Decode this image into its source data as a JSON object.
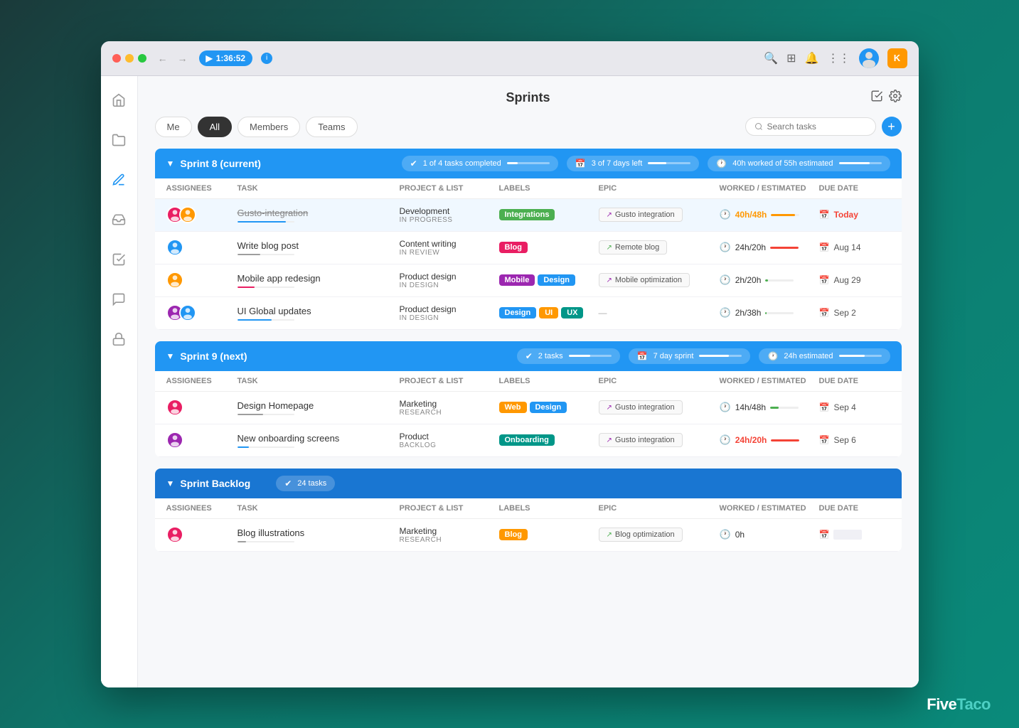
{
  "browser": {
    "timer": "1:36:52",
    "user_initial": "K"
  },
  "page": {
    "title": "Sprints"
  },
  "filters": {
    "tabs": [
      "Me",
      "All",
      "Members",
      "Teams"
    ],
    "active": "All",
    "search_placeholder": "Search tasks"
  },
  "sprints": [
    {
      "id": "sprint8",
      "name": "Sprint 8 (current)",
      "stats": [
        {
          "icon": "✔",
          "label": "1 of 4 tasks completed",
          "progress": 25
        },
        {
          "icon": "📅",
          "label": "3 of 7 days left",
          "progress": 43
        },
        {
          "icon": "🕐",
          "label": "40h worked of 55h estimated",
          "progress": 73
        }
      ],
      "columns": [
        "Assignees",
        "Task",
        "Project & List",
        "Labels",
        "Epic",
        "Worked / Estimated",
        "Due date"
      ],
      "rows": [
        {
          "assignees": [
            "#e91e63",
            "#ff9800"
          ],
          "task": "Gusto-integration",
          "task_strikethrough": true,
          "progress": 85,
          "progress_color": "#2196f3",
          "project": "Development",
          "list": "IN PROGRESS",
          "labels": [
            {
              "text": "Integrations",
              "color": "label-green"
            }
          ],
          "epic": "Gusto integration",
          "epic_color": "#9c27b0",
          "worked": "40h/48h",
          "worked_over": true,
          "worked_progress": 83,
          "worked_color": "#ff9800",
          "due": "Today",
          "due_today": true,
          "highlighted": true
        },
        {
          "assignees": [
            "#2196f3"
          ],
          "task": "Write blog post",
          "task_strikethrough": false,
          "progress": 40,
          "progress_color": "#9e9e9e",
          "project": "Content writing",
          "list": "IN REVIEW",
          "labels": [
            {
              "text": "Blog",
              "color": "label-red"
            }
          ],
          "epic": "Remote blog",
          "epic_color": "#4caf50",
          "worked": "24h/20h",
          "worked_over": true,
          "worked_progress": 100,
          "worked_color": "#f44336",
          "due": "Aug 14",
          "due_today": false,
          "highlighted": false
        },
        {
          "assignees": [
            "#ff9800"
          ],
          "task": "Mobile app redesign",
          "task_strikethrough": false,
          "progress": 30,
          "progress_color": "#e91e63",
          "project": "Product design",
          "list": "IN DESIGN",
          "labels": [
            {
              "text": "Mobile",
              "color": "label-purple"
            },
            {
              "text": "Design",
              "color": "label-blue"
            }
          ],
          "epic": "Mobile optimization",
          "epic_color": "#9c27b0",
          "worked": "2h/20h",
          "worked_over": false,
          "worked_progress": 10,
          "worked_color": "#4caf50",
          "due": "Aug 29",
          "due_today": false,
          "highlighted": false
        },
        {
          "assignees": [
            "#9c27b0",
            "#2196f3"
          ],
          "task": "UI Global updates",
          "task_strikethrough": false,
          "progress": 60,
          "progress_color": "#2196f3",
          "project": "Product design",
          "list": "IN DESIGN",
          "labels": [
            {
              "text": "Design",
              "color": "label-blue"
            },
            {
              "text": "UI",
              "color": "label-orange"
            },
            {
              "text": "UX",
              "color": "label-teal"
            }
          ],
          "epic": "—",
          "epic_color": "",
          "worked": "2h/38h",
          "worked_over": false,
          "worked_progress": 5,
          "worked_color": "#4caf50",
          "due": "Sep 2",
          "due_today": false,
          "highlighted": false
        }
      ]
    },
    {
      "id": "sprint9",
      "name": "Sprint 9 (next)",
      "stats": [
        {
          "icon": "✔",
          "label": "2 tasks",
          "progress": 50
        },
        {
          "icon": "📅",
          "label": "7 day sprint",
          "progress": 70
        },
        {
          "icon": "🕐",
          "label": "24h estimated",
          "progress": 60
        }
      ],
      "columns": [
        "Assignees",
        "Task",
        "Project & List",
        "Labels",
        "Epic",
        "Worked / Estimated",
        "Due date"
      ],
      "rows": [
        {
          "assignees": [
            "#e91e63"
          ],
          "task": "Design Homepage",
          "task_strikethrough": false,
          "progress": 45,
          "progress_color": "#9e9e9e",
          "project": "Marketing",
          "list": "RESEARCH",
          "labels": [
            {
              "text": "Web",
              "color": "label-orange"
            },
            {
              "text": "Design",
              "color": "label-blue"
            }
          ],
          "epic": "Gusto integration",
          "epic_color": "#9c27b0",
          "worked": "14h/48h",
          "worked_over": false,
          "worked_progress": 29,
          "worked_color": "#4caf50",
          "due": "Sep 4",
          "due_today": false,
          "highlighted": false
        },
        {
          "assignees": [
            "#9c27b0"
          ],
          "task": "New onboarding screens",
          "task_strikethrough": false,
          "progress": 20,
          "progress_color": "#2196f3",
          "project": "Product",
          "list": "BACKLOG",
          "labels": [
            {
              "text": "Onboarding",
              "color": "label-teal"
            }
          ],
          "epic": "Gusto integration",
          "epic_color": "#9c27b0",
          "worked": "24h/20h",
          "worked_over": true,
          "worked_progress": 100,
          "worked_color": "#f44336",
          "due": "Sep 6",
          "due_today": false,
          "highlighted": false
        }
      ]
    }
  ],
  "backlog": {
    "name": "Sprint Backlog",
    "stat": "24 tasks",
    "columns": [
      "Assignees",
      "Task",
      "Project & List",
      "Labels",
      "Epic",
      "Worked / Estimated",
      "Due date"
    ],
    "rows": [
      {
        "assignees": [
          "#e91e63"
        ],
        "task": "Blog illustrations",
        "task_strikethrough": false,
        "progress": 15,
        "progress_color": "#9e9e9e",
        "project": "Marketing",
        "list": "RESEARCH",
        "labels": [
          {
            "text": "Blog",
            "color": "label-orange"
          }
        ],
        "epic": "Blog optimization",
        "epic_color": "#4caf50",
        "worked": "0h",
        "worked_over": false,
        "worked_progress": 0,
        "worked_color": "#4caf50",
        "due": "",
        "due_today": false
      }
    ]
  },
  "sidebar": {
    "items": [
      {
        "icon": "🏠",
        "name": "home"
      },
      {
        "icon": "📁",
        "name": "folders"
      },
      {
        "icon": "✏️",
        "name": "pen"
      },
      {
        "icon": "📥",
        "name": "inbox"
      },
      {
        "icon": "✅",
        "name": "tasks"
      },
      {
        "icon": "💬",
        "name": "messages"
      },
      {
        "icon": "🔒",
        "name": "lock"
      }
    ]
  },
  "branding": "FiveTaco"
}
